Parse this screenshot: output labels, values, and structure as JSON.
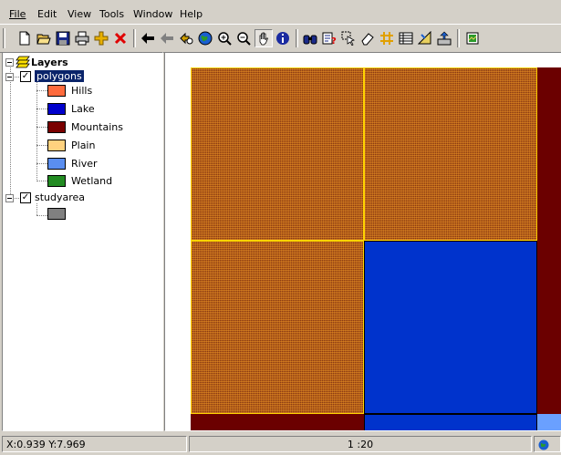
{
  "menu": {
    "items": [
      {
        "label": "File"
      },
      {
        "label": "Edit"
      },
      {
        "label": "View"
      },
      {
        "label": "Tools"
      },
      {
        "label": "Window"
      },
      {
        "label": "Help"
      }
    ]
  },
  "toolbar": {
    "buttons": [
      "new-icon",
      "open-icon",
      "save-icon",
      "print-icon",
      "add-layer-icon",
      "remove-layer-icon",
      "back-icon",
      "forward-icon",
      "zoom-previous-icon",
      "full-extent-icon",
      "zoom-in-icon",
      "zoom-out-icon",
      "pan-icon",
      "info-icon",
      "find-icon",
      "query-icon",
      "select-icon",
      "eraser-icon",
      "grid-icon",
      "table-icon",
      "measure-icon",
      "export-icon",
      "properties-icon"
    ],
    "pressed": "pan-icon"
  },
  "layers": {
    "root_label": "Layers",
    "groups": [
      {
        "name": "polygons",
        "checked": true,
        "selected": true,
        "classes": [
          {
            "label": "Hills",
            "color": "#ff6b3d"
          },
          {
            "label": "Lake",
            "color": "#0000cc"
          },
          {
            "label": "Mountains",
            "color": "#7a0000"
          },
          {
            "label": "Plain",
            "color": "#ffd27f"
          },
          {
            "label": "River",
            "color": "#5a8ef0"
          },
          {
            "label": "Wetland",
            "color": "#228b22"
          }
        ]
      },
      {
        "name": "studyarea",
        "checked": true,
        "selected": false,
        "classes": [
          {
            "label": "",
            "color": "#808080"
          }
        ]
      }
    ]
  },
  "map": {
    "colors": {
      "hills": "#8b3a12",
      "lake": "#0033cc",
      "mountains": "#6b0000",
      "river": "#6aa0ff",
      "outline": "#ffd400"
    }
  },
  "status": {
    "coordinates": "X:0.939 Y:7.969",
    "scale": "1 :20"
  }
}
